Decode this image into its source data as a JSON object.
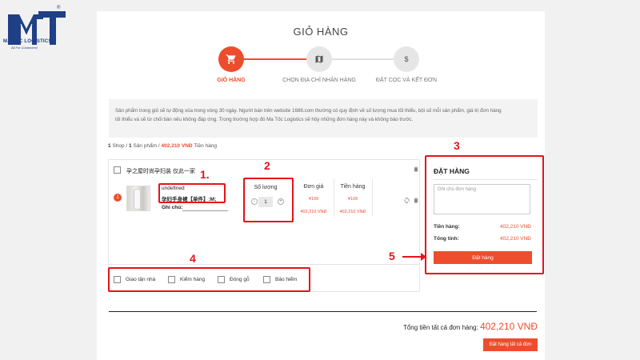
{
  "brand": {
    "name": "MA TOC LOGISTICS",
    "tagline": "All For Customers!",
    "reg_mark": "®",
    "logo_letters": "MT"
  },
  "page_title": "GIỎ HÀNG",
  "steps": [
    {
      "label": "GIỎ HÀNG",
      "icon": "cart-icon"
    },
    {
      "label": "CHỌN ĐỊA CHỈ NHẬN HÀNG",
      "icon": "map-icon"
    },
    {
      "label": "ĐẶT CỌC VÀ KẾT ĐƠN",
      "icon": "dollar-icon"
    }
  ],
  "notice": {
    "line1": "Sản phẩm trong giỏ sẽ tự động xóa trong vòng 30 ngày. Người bán trên website 1688.com thường có quy định về số lượng mua tối thiểu, bội số mỗi sản phẩm, giá trị đơn hàng",
    "line2": "tối thiểu và sẽ từ chối bán nếu không đáp ứng. Trong trường hợp đó Ma Tốc Logistics sẽ hủy những đơn hàng này và không báo trước."
  },
  "summary": {
    "shops": "1",
    "shop_label": "Shop /",
    "products": "1",
    "product_label": "Sản phẩm /",
    "amount": "402,210 VNĐ",
    "amount_label": "Tiền hàng"
  },
  "cart": {
    "shop_name": "孕之屋时尚孕妇装 仅此一家",
    "item_index": "1",
    "product_line1": "undefined",
    "product_line2": "孕妇手身裙【单件】:M;",
    "note_label": "Ghi chú:",
    "qty_header": "Số lượng",
    "qty_value": "1",
    "qty_minus": "-",
    "qty_plus": "+",
    "unit_price_header": "Đơn giá",
    "unit_price_cny": "¥109",
    "unit_price_vnd": "402,210 VNĐ",
    "amount_header": "Tiền hàng",
    "amount_cny": "¥109",
    "amount_vnd": "402,210 VNĐ"
  },
  "services": [
    "Giao tận nhà",
    "Kiểm hàng",
    "Đóng gỗ",
    "Bảo hiểm"
  ],
  "order_panel": {
    "title": "ĐẶT HÀNG",
    "note_placeholder": "Ghi chú đơn hàng",
    "goods_label": "Tiền hàng:",
    "goods_value": "402,210 VNĐ",
    "total_label": "Tổng tính:",
    "total_value": "402,210 VNĐ",
    "button": "Đặt hàng"
  },
  "grand_total": {
    "label": "Tổng tiền tất cả đơn hàng:",
    "value": "402,210 VNĐ",
    "button": "Đặt hàng tất cả đơn"
  },
  "annotations": [
    "1.",
    "2",
    "3",
    "4",
    "5"
  ],
  "colors": {
    "accent": "#ee4d2d",
    "annotation": "#e8111b",
    "brand": "#1f3f86"
  }
}
